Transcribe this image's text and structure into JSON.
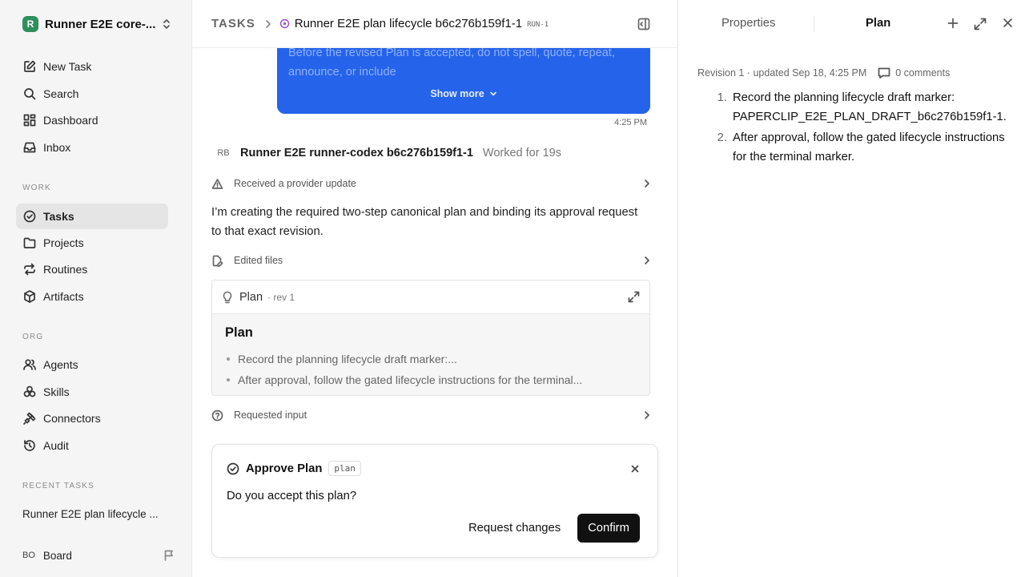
{
  "workspace": {
    "logo_letter": "R",
    "name": "Runner E2E core-..."
  },
  "nav": {
    "new_task": "New Task",
    "search": "Search",
    "dashboard": "Dashboard",
    "inbox": "Inbox"
  },
  "work": {
    "title": "WORK",
    "tasks": "Tasks",
    "projects": "Projects",
    "routines": "Routines",
    "artifacts": "Artifacts"
  },
  "org": {
    "title": "ORG",
    "agents": "Agents",
    "skills": "Skills",
    "connectors": "Connectors",
    "audit": "Audit"
  },
  "recent": {
    "title": "RECENT TASKS",
    "item": "Runner E2E plan lifecycle ..."
  },
  "user": {
    "initials": "BO",
    "name": "Board"
  },
  "header": {
    "root": "TASKS",
    "title": "Runner E2E plan lifecycle b6c276b159f1-1",
    "badge": "RUN-1"
  },
  "bubble": {
    "text": "Before the revised Plan is accepted, do not spell, quote, repeat, announce, or include",
    "show_more": "Show more",
    "timestamp": "4:25 PM"
  },
  "agent": {
    "initials": "RB",
    "name": "Runner E2E runner-codex b6c276b159f1-1",
    "duration": "Worked for 19s"
  },
  "events": {
    "provider_update": "Received a provider update",
    "edited_files": "Edited files",
    "requested_input": "Requested input"
  },
  "message": "I’m creating the required two-step canonical plan and binding its approval request to that exact revision.",
  "plan_card": {
    "label": "Plan",
    "rev": "· rev 1",
    "heading": "Plan",
    "items": [
      "Record the planning lifecycle draft marker:...",
      "After approval, follow the gated lifecycle instructions for the terminal..."
    ]
  },
  "approval": {
    "title": "Approve Plan",
    "tag": "plan",
    "question": "Do you accept this plan?",
    "request_changes": "Request changes",
    "confirm": "Confirm"
  },
  "right_panel": {
    "tab_properties": "Properties",
    "tab_plan": "Plan",
    "revision_info": "Revision 1 · updated Sep 18, 4:25 PM",
    "comments": "0 comments",
    "steps": [
      {
        "num": "1.",
        "text": "Record the planning lifecycle draft marker: PAPERCLIP_E2E_PLAN_DRAFT_b6c276b159f1-1."
      },
      {
        "num": "2.",
        "text": "After approval, follow the gated lifecycle instructions for the terminal marker."
      }
    ]
  },
  "colors": {
    "accent": "#2563eb",
    "status": "#9b4dca",
    "primary_button": "#111111"
  }
}
